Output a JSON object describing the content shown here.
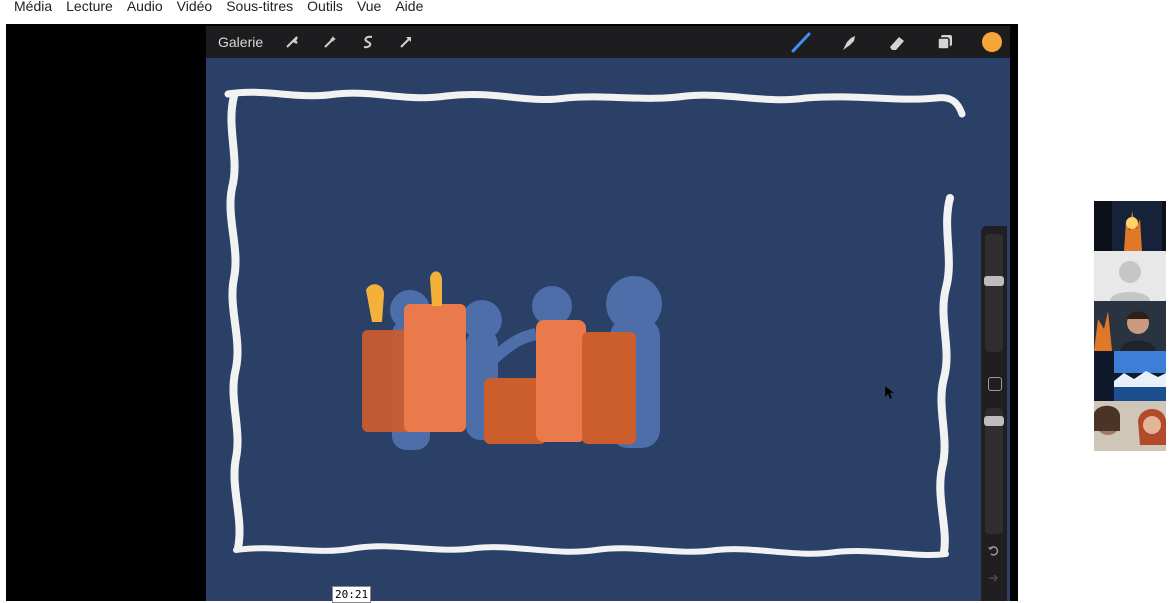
{
  "menubar": {
    "items": [
      "Média",
      "Lecture",
      "Audio",
      "Vidéo",
      "Sous-titres",
      "Outils",
      "Vue",
      "Aide"
    ]
  },
  "toolbar": {
    "gallery_label": "Galerie",
    "left_icons": [
      "wrench-icon",
      "magic-wand-icon",
      "selection-icon",
      "transform-arrow-icon"
    ],
    "right_icons": [
      "brush-icon",
      "smudge-icon",
      "eraser-icon",
      "layers-icon"
    ],
    "active_color": "#f6a53a"
  },
  "canvas": {
    "background": "#2a4066",
    "frame_color": "#f2f2f2"
  },
  "side_controls": {
    "undo_icon": "undo-icon",
    "redo_icon": "redo-icon"
  },
  "player": {
    "timestamp": "20:21"
  },
  "participants": {
    "count": 5
  }
}
